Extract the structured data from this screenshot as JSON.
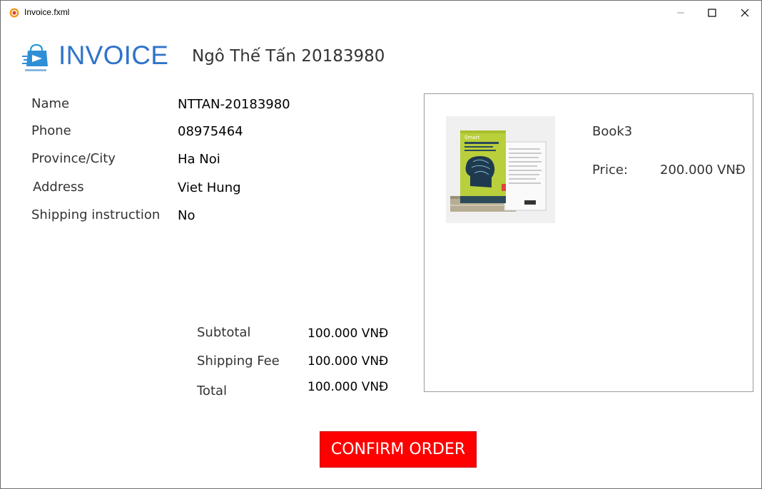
{
  "window": {
    "title": "Invoice.fxml",
    "controls": [
      "minimize-icon",
      "maximize-icon",
      "close-icon"
    ]
  },
  "header": {
    "title": "INVOICE",
    "user_name": "Ngô Thế Tấn 20183980",
    "logo_icon": "shopping-bag-logo-icon",
    "title_color": "#2f74c9"
  },
  "fields": [
    {
      "label": "Name",
      "value": "NTTAN-20183980"
    },
    {
      "label": "Phone",
      "value": "08975464"
    },
    {
      "label": "Province/City",
      "value": "Ha Noi"
    },
    {
      "label": "Address",
      "value": "Viet Hung"
    },
    {
      "label": "Shipping instruction",
      "value": "No"
    }
  ],
  "totals": [
    {
      "label": "Subtotal",
      "value": "100.000 VNĐ"
    },
    {
      "label": "Shipping Fee",
      "value": "100.000 VNĐ"
    },
    {
      "label": "Total",
      "value": "100.000 VNĐ"
    }
  ],
  "product": {
    "name": "Book3",
    "price_label": "Price:",
    "price_value": "200.000 VNĐ",
    "image_icon": "book-cover-image"
  },
  "confirm": {
    "label": "CONFIRM ORDER",
    "color": "#ff0000"
  }
}
